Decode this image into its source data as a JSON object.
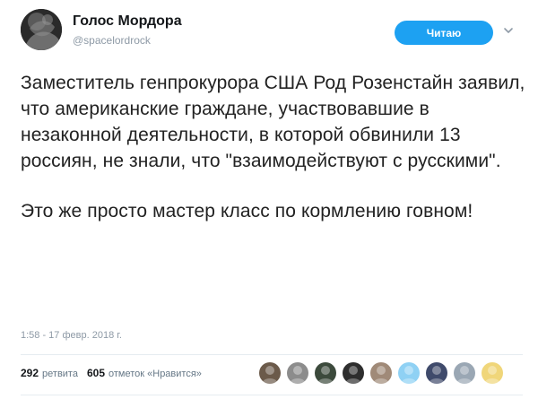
{
  "tweet": {
    "author_name": "Голос Мордора",
    "author_handle": "@spacelordrock",
    "follow_label": "Читаю",
    "text_paragraphs": [
      "Заместитель генпрокурора США Род Розенстайн заявил, что американские граждане, участвовавшие в незаконной деятельности, в которой обвинили 13 россиян, не знали, что \"взаимодействуют с русскими\".",
      "Это же просто мастер класс по кормлению говном!"
    ],
    "timestamp": "1:58 - 17 февр. 2018 г."
  },
  "stats": {
    "retweets_count": "292",
    "retweets_label": "ретвита",
    "likes_count": "605",
    "likes_label": "отметок «Нравится»"
  },
  "liker_avatars": [
    {
      "icon": "user-avatar-icon",
      "color": "#6b5a4a"
    },
    {
      "icon": "user-avatar-icon",
      "color": "#8c8c8c"
    },
    {
      "icon": "user-avatar-icon",
      "color": "#3c4a3c"
    },
    {
      "icon": "user-avatar-icon",
      "color": "#2e2e2e"
    },
    {
      "icon": "user-avatar-icon",
      "color": "#a08a78"
    },
    {
      "icon": "user-avatar-icon",
      "color": "#8fd1f4"
    },
    {
      "icon": "user-avatar-icon",
      "color": "#3f4a6b"
    },
    {
      "icon": "user-avatar-icon",
      "color": "#9aa7b4"
    },
    {
      "icon": "user-avatar-icon",
      "color": "#f0d67a"
    }
  ],
  "colors": {
    "accent": "#1da1f2",
    "muted_text": "#8e9aa6",
    "divider": "#e6ecf0"
  }
}
